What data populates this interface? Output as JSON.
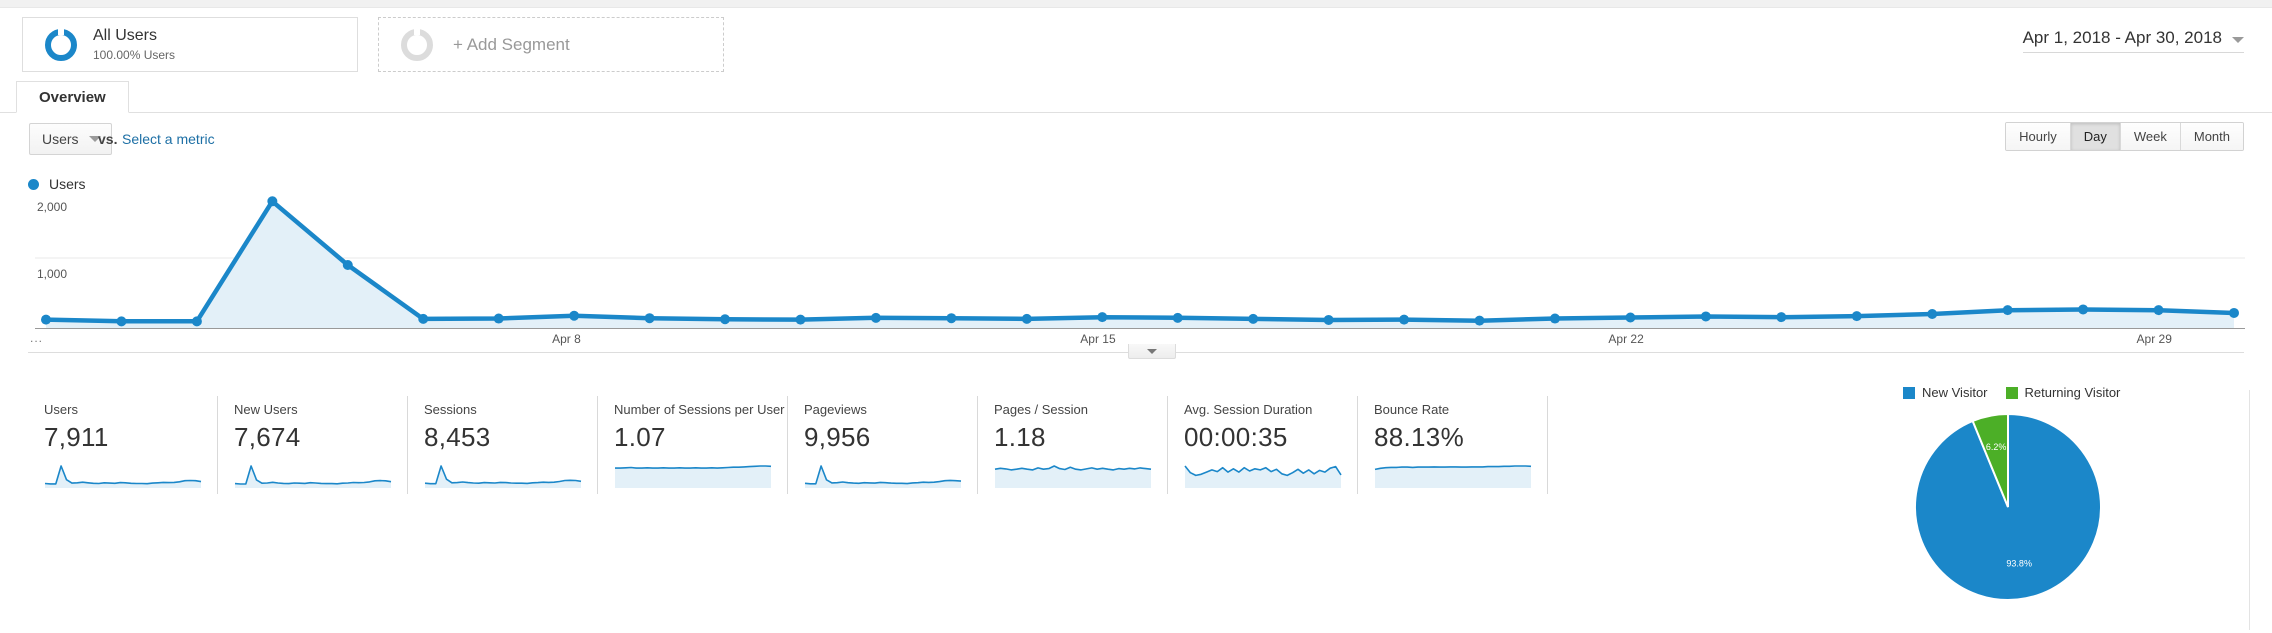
{
  "segment_bar": {
    "all_users": {
      "title": "All Users",
      "subtitle": "100.00% Users",
      "icon": "donut-icon"
    },
    "add_segment": {
      "label": "+ Add Segment",
      "icon": "donut-empty-icon"
    },
    "date_range": {
      "label": "Apr 1, 2018 - Apr 30, 2018",
      "icon": "chevron-down-icon"
    }
  },
  "tabs": [
    {
      "label": "Overview",
      "active": true
    }
  ],
  "metric_row": {
    "selected_metric": "Users",
    "dropdown_icon": "chevron-down-icon",
    "vs_label": "vs.",
    "compare_link": "Select a metric",
    "granularity": [
      {
        "label": "Hourly",
        "active": false
      },
      {
        "label": "Day",
        "active": true
      },
      {
        "label": "Week",
        "active": false
      },
      {
        "label": "Month",
        "active": false
      }
    ]
  },
  "chart_legend": {
    "label": "Users",
    "color": "#1b87c9"
  },
  "collapse_control": {
    "icon": "chevron-down-icon"
  },
  "metric_cards": [
    {
      "label": "Users",
      "value": "7,911",
      "filled": false
    },
    {
      "label": "New Users",
      "value": "7,674",
      "filled": false
    },
    {
      "label": "Sessions",
      "value": "8,453",
      "filled": false
    },
    {
      "label": "Number of Sessions per User",
      "value": "1.07",
      "filled": true
    },
    {
      "label": "Pageviews",
      "value": "9,956",
      "filled": false
    },
    {
      "label": "Pages / Session",
      "value": "1.18",
      "filled": true
    },
    {
      "label": "Avg. Session Duration",
      "value": "00:00:35",
      "filled": true
    },
    {
      "label": "Bounce Rate",
      "value": "88.13%",
      "filled": true
    }
  ],
  "pie_legend": [
    {
      "label": "New Visitor",
      "color": "#1b87c9"
    },
    {
      "label": "Returning Visitor",
      "color": "#4caf27"
    }
  ],
  "chart_data": [
    {
      "type": "area",
      "id": "users-over-time",
      "title": "Users",
      "xlabel": "",
      "ylabel": "Users",
      "ylim": [
        0,
        2000
      ],
      "yticks": [
        1000,
        2000
      ],
      "ytick_labels": [
        "1,000",
        "2,000"
      ],
      "grid": true,
      "legend_position": "top-left",
      "xtick_labels": [
        "Apr 8",
        "Apr 15",
        "Apr 22",
        "Apr 29"
      ],
      "xtick_indices": [
        7,
        14,
        21,
        28
      ],
      "x": [
        "Apr 1",
        "Apr 2",
        "Apr 3",
        "Apr 4",
        "Apr 5",
        "Apr 6",
        "Apr 7",
        "Apr 8",
        "Apr 9",
        "Apr 10",
        "Apr 11",
        "Apr 12",
        "Apr 13",
        "Apr 14",
        "Apr 15",
        "Apr 16",
        "Apr 17",
        "Apr 18",
        "Apr 19",
        "Apr 20",
        "Apr 21",
        "Apr 22",
        "Apr 23",
        "Apr 24",
        "Apr 25",
        "Apr 26",
        "Apr 27",
        "Apr 28",
        "Apr 29",
        "Apr 30"
      ],
      "series": [
        {
          "name": "Users",
          "color": "#1b87c9",
          "values": [
            120,
            95,
            95,
            1810,
            900,
            130,
            135,
            175,
            140,
            125,
            120,
            145,
            140,
            130,
            155,
            145,
            130,
            115,
            120,
            105,
            135,
            150,
            165,
            155,
            170,
            200,
            255,
            265,
            255,
            215
          ]
        }
      ]
    },
    {
      "type": "pie",
      "id": "new-vs-returning",
      "title": "",
      "labels": [
        "New Visitor",
        "Returning Visitor"
      ],
      "values": [
        93.8,
        6.2
      ],
      "value_labels": [
        "93.8%",
        "6.2%"
      ],
      "colors": [
        "#1b87c9",
        "#4caf27"
      ],
      "legend_position": "top"
    },
    {
      "type": "line",
      "id": "sparkline-users",
      "values": [
        12,
        10,
        10,
        95,
        30,
        14,
        15,
        18,
        15,
        13,
        12,
        15,
        14,
        13,
        16,
        15,
        13,
        12,
        12,
        11,
        14,
        15,
        17,
        16,
        17,
        20,
        25,
        26,
        25,
        21
      ],
      "fill": false
    },
    {
      "type": "line",
      "id": "sparkline-new-users",
      "values": [
        11,
        9,
        9,
        92,
        28,
        13,
        14,
        17,
        14,
        12,
        11,
        14,
        13,
        12,
        15,
        14,
        12,
        11,
        11,
        10,
        13,
        14,
        16,
        15,
        16,
        19,
        24,
        25,
        24,
        20
      ],
      "fill": false
    },
    {
      "type": "line",
      "id": "sparkline-sessions",
      "values": [
        13,
        11,
        11,
        94,
        32,
        15,
        16,
        19,
        16,
        14,
        13,
        16,
        15,
        14,
        17,
        16,
        14,
        13,
        13,
        12,
        15,
        16,
        18,
        17,
        18,
        21,
        26,
        27,
        26,
        22
      ],
      "fill": false
    },
    {
      "type": "line",
      "id": "sparkline-sessions-per-user",
      "values": [
        60,
        60,
        61,
        62,
        60,
        60,
        61,
        60,
        60,
        61,
        60,
        60,
        61,
        60,
        60,
        61,
        60,
        60,
        61,
        60,
        61,
        62,
        63,
        63,
        64,
        65,
        66,
        67,
        67,
        66
      ],
      "fill": true
    },
    {
      "type": "line",
      "id": "sparkline-pageviews",
      "values": [
        12,
        10,
        10,
        90,
        28,
        14,
        15,
        18,
        15,
        13,
        12,
        15,
        14,
        13,
        16,
        15,
        13,
        12,
        12,
        11,
        14,
        15,
        17,
        16,
        17,
        20,
        24,
        25,
        24,
        22
      ],
      "fill": false
    },
    {
      "type": "line",
      "id": "sparkline-pages-per-session",
      "values": [
        52,
        55,
        53,
        50,
        52,
        55,
        52,
        50,
        56,
        52,
        54,
        62,
        54,
        51,
        58,
        52,
        50,
        53,
        56,
        52,
        55,
        52,
        50,
        54,
        52,
        55,
        53,
        56,
        54,
        52
      ],
      "fill": true
    },
    {
      "type": "line",
      "id": "sparkline-session-duration",
      "values": [
        72,
        48,
        38,
        42,
        50,
        58,
        52,
        66,
        50,
        62,
        50,
        66,
        54,
        62,
        58,
        66,
        52,
        60,
        44,
        38,
        48,
        60,
        46,
        58,
        44,
        56,
        50,
        64,
        70,
        40
      ],
      "fill": true
    },
    {
      "type": "line",
      "id": "sparkline-bounce-rate",
      "values": [
        58,
        62,
        64,
        65,
        65,
        66,
        66,
        65,
        66,
        66,
        66,
        67,
        66,
        66,
        67,
        67,
        66,
        66,
        67,
        67,
        67,
        68,
        68,
        68,
        69,
        69,
        70,
        70,
        70,
        69
      ],
      "fill": true
    }
  ]
}
